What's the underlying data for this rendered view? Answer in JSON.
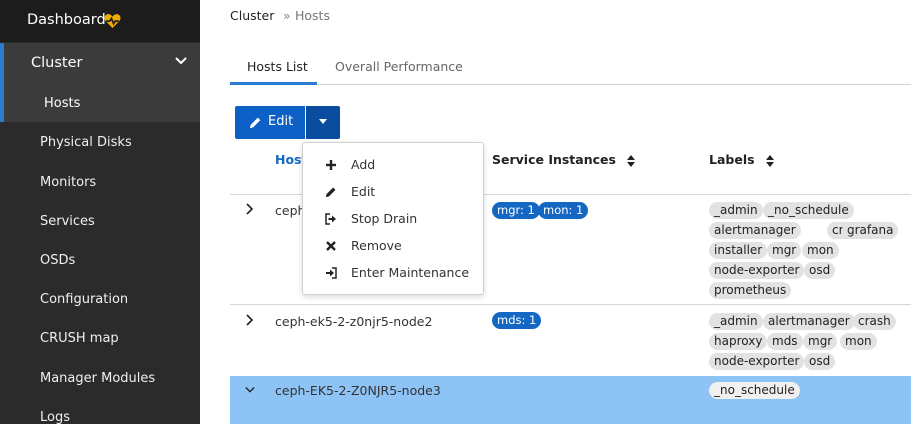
{
  "sidebar": {
    "dashboard_label": "Dashboard",
    "cluster_label": "Cluster",
    "hosts_label": "Hosts",
    "items": [
      {
        "label": "Physical Disks"
      },
      {
        "label": "Monitors"
      },
      {
        "label": "Services"
      },
      {
        "label": "OSDs"
      },
      {
        "label": "Configuration"
      },
      {
        "label": "CRUSH map"
      },
      {
        "label": "Manager Modules"
      },
      {
        "label": "Logs"
      }
    ]
  },
  "breadcrumb": {
    "root": "Cluster",
    "current": "Hosts"
  },
  "tabs": [
    {
      "label": "Hosts List"
    },
    {
      "label": "Overall Performance"
    }
  ],
  "toolbar": {
    "edit_label": "Edit"
  },
  "dropdown": {
    "items": [
      {
        "label": "Add",
        "icon": "plus-icon"
      },
      {
        "label": "Edit",
        "icon": "pencil-icon"
      },
      {
        "label": "Stop Drain",
        "icon": "sign-out-icon"
      },
      {
        "label": "Remove",
        "icon": "times-icon"
      },
      {
        "label": "Enter Maintenance",
        "icon": "sign-in-icon"
      }
    ]
  },
  "table": {
    "columns": {
      "hostname": "Hostname",
      "services": "Service Instances",
      "labels": "Labels"
    },
    "rows": [
      {
        "hostname": "ceph-ek5-2-z0njr5-node1",
        "services": [
          "mgr: 1",
          "mon: 1"
        ],
        "labels": [
          "_admin",
          "_no_schedule",
          "alertmanager",
          "crash",
          "grafana",
          "installer",
          "mgr",
          "mon",
          "node-exporter",
          "osd",
          "prometheus"
        ]
      },
      {
        "hostname": "ceph-ek5-2-z0njr5-node2",
        "services": [
          "mds: 1"
        ],
        "labels": [
          "_admin",
          "alertmanager",
          "crash",
          "haproxy",
          "mds",
          "mgr",
          "mon",
          "node-exporter",
          "osd"
        ]
      },
      {
        "hostname": "ceph-EK5-2-Z0NJR5-node3",
        "services": [],
        "labels": [
          "_no_schedule"
        ]
      }
    ]
  },
  "colors": {
    "accent": "#2b7bd1",
    "primary_button": "#0d60c5",
    "selected_row": "#8ec3f5",
    "sidebar_bg": "#2b2b2b"
  }
}
